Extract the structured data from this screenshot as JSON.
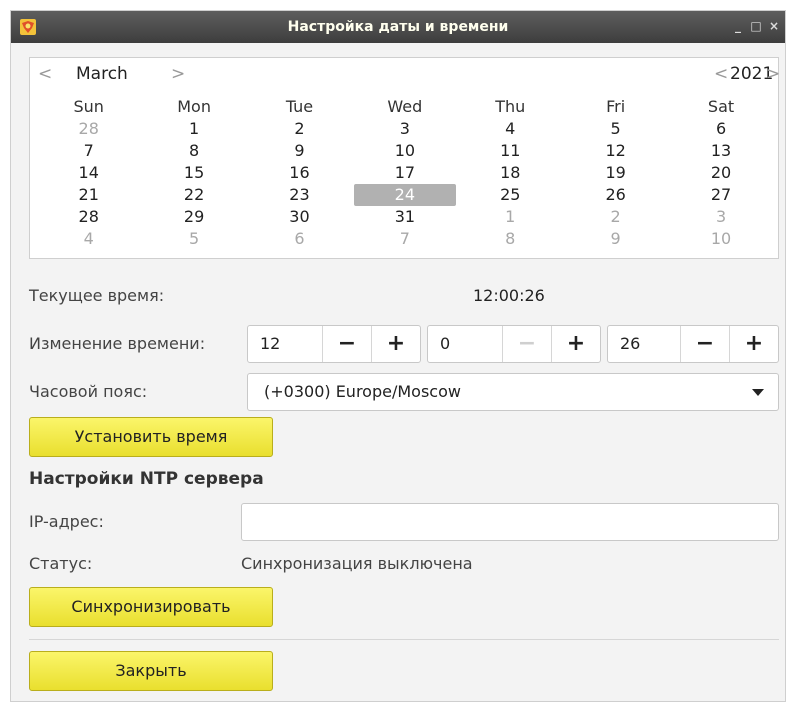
{
  "window": {
    "title": "Настройка даты и времени",
    "controls": {
      "minimize": "_",
      "maximize": "□",
      "close": "×"
    }
  },
  "calendar": {
    "month": "March",
    "year": "2021",
    "nav": {
      "prev": "<",
      "next": ">"
    },
    "weekdays": [
      "Sun",
      "Mon",
      "Tue",
      "Wed",
      "Thu",
      "Fri",
      "Sat"
    ],
    "weeks": [
      [
        {
          "d": "28",
          "o": true
        },
        {
          "d": "1"
        },
        {
          "d": "2"
        },
        {
          "d": "3"
        },
        {
          "d": "4"
        },
        {
          "d": "5"
        },
        {
          "d": "6"
        }
      ],
      [
        {
          "d": "7"
        },
        {
          "d": "8"
        },
        {
          "d": "9"
        },
        {
          "d": "10"
        },
        {
          "d": "11"
        },
        {
          "d": "12"
        },
        {
          "d": "13"
        }
      ],
      [
        {
          "d": "14"
        },
        {
          "d": "15"
        },
        {
          "d": "16"
        },
        {
          "d": "17"
        },
        {
          "d": "18"
        },
        {
          "d": "19"
        },
        {
          "d": "20"
        }
      ],
      [
        {
          "d": "21"
        },
        {
          "d": "22"
        },
        {
          "d": "23"
        },
        {
          "d": "24",
          "s": true
        },
        {
          "d": "25"
        },
        {
          "d": "26"
        },
        {
          "d": "27"
        }
      ],
      [
        {
          "d": "28"
        },
        {
          "d": "29"
        },
        {
          "d": "30"
        },
        {
          "d": "31"
        },
        {
          "d": "1",
          "o": true
        },
        {
          "d": "2",
          "o": true
        },
        {
          "d": "3",
          "o": true
        }
      ],
      [
        {
          "d": "4",
          "o": true
        },
        {
          "d": "5",
          "o": true
        },
        {
          "d": "6",
          "o": true
        },
        {
          "d": "7",
          "o": true
        },
        {
          "d": "8",
          "o": true
        },
        {
          "d": "9",
          "o": true
        },
        {
          "d": "10",
          "o": true
        }
      ]
    ]
  },
  "time": {
    "current_label": "Текущее время:",
    "current_value": "12:00:26",
    "change_label": "Изменение времени:",
    "hours": "12",
    "minutes": "0",
    "seconds": "26",
    "minus": "−",
    "plus": "+",
    "timezone_label": "Часовой пояс:",
    "timezone_value": "(+0300) Europe/Moscow",
    "set_button": "Установить время"
  },
  "ntp": {
    "title": "Настройки NTP сервера",
    "ip_label": "IP-адрес:",
    "ip_value": "",
    "status_label": "Статус:",
    "status_value": "Синхронизация выключена",
    "sync_button": "Синхронизировать"
  },
  "footer": {
    "close_button": "Закрыть"
  }
}
